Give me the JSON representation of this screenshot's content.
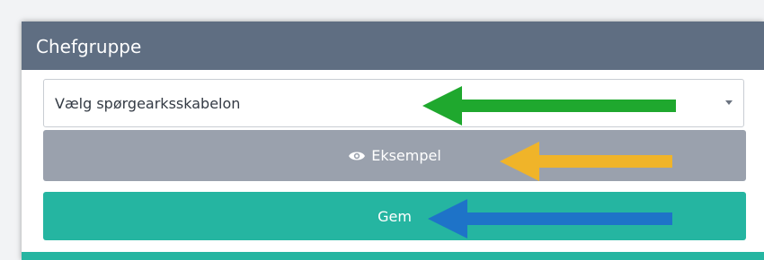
{
  "panel": {
    "title": "Chefgruppe"
  },
  "template_select": {
    "value": "Vælg spørgearksskabelon"
  },
  "buttons": {
    "preview_label": "Eksempel",
    "save_label": "Gem"
  },
  "colors": {
    "header": "#5f6e82",
    "preview_button": "#9aa1ad",
    "save_button": "#25b5a1",
    "arrow_select": "#1fa82e",
    "arrow_preview": "#f0b429",
    "arrow_save": "#1e73c8"
  },
  "icons": {
    "preview_icon": "eye-icon"
  }
}
